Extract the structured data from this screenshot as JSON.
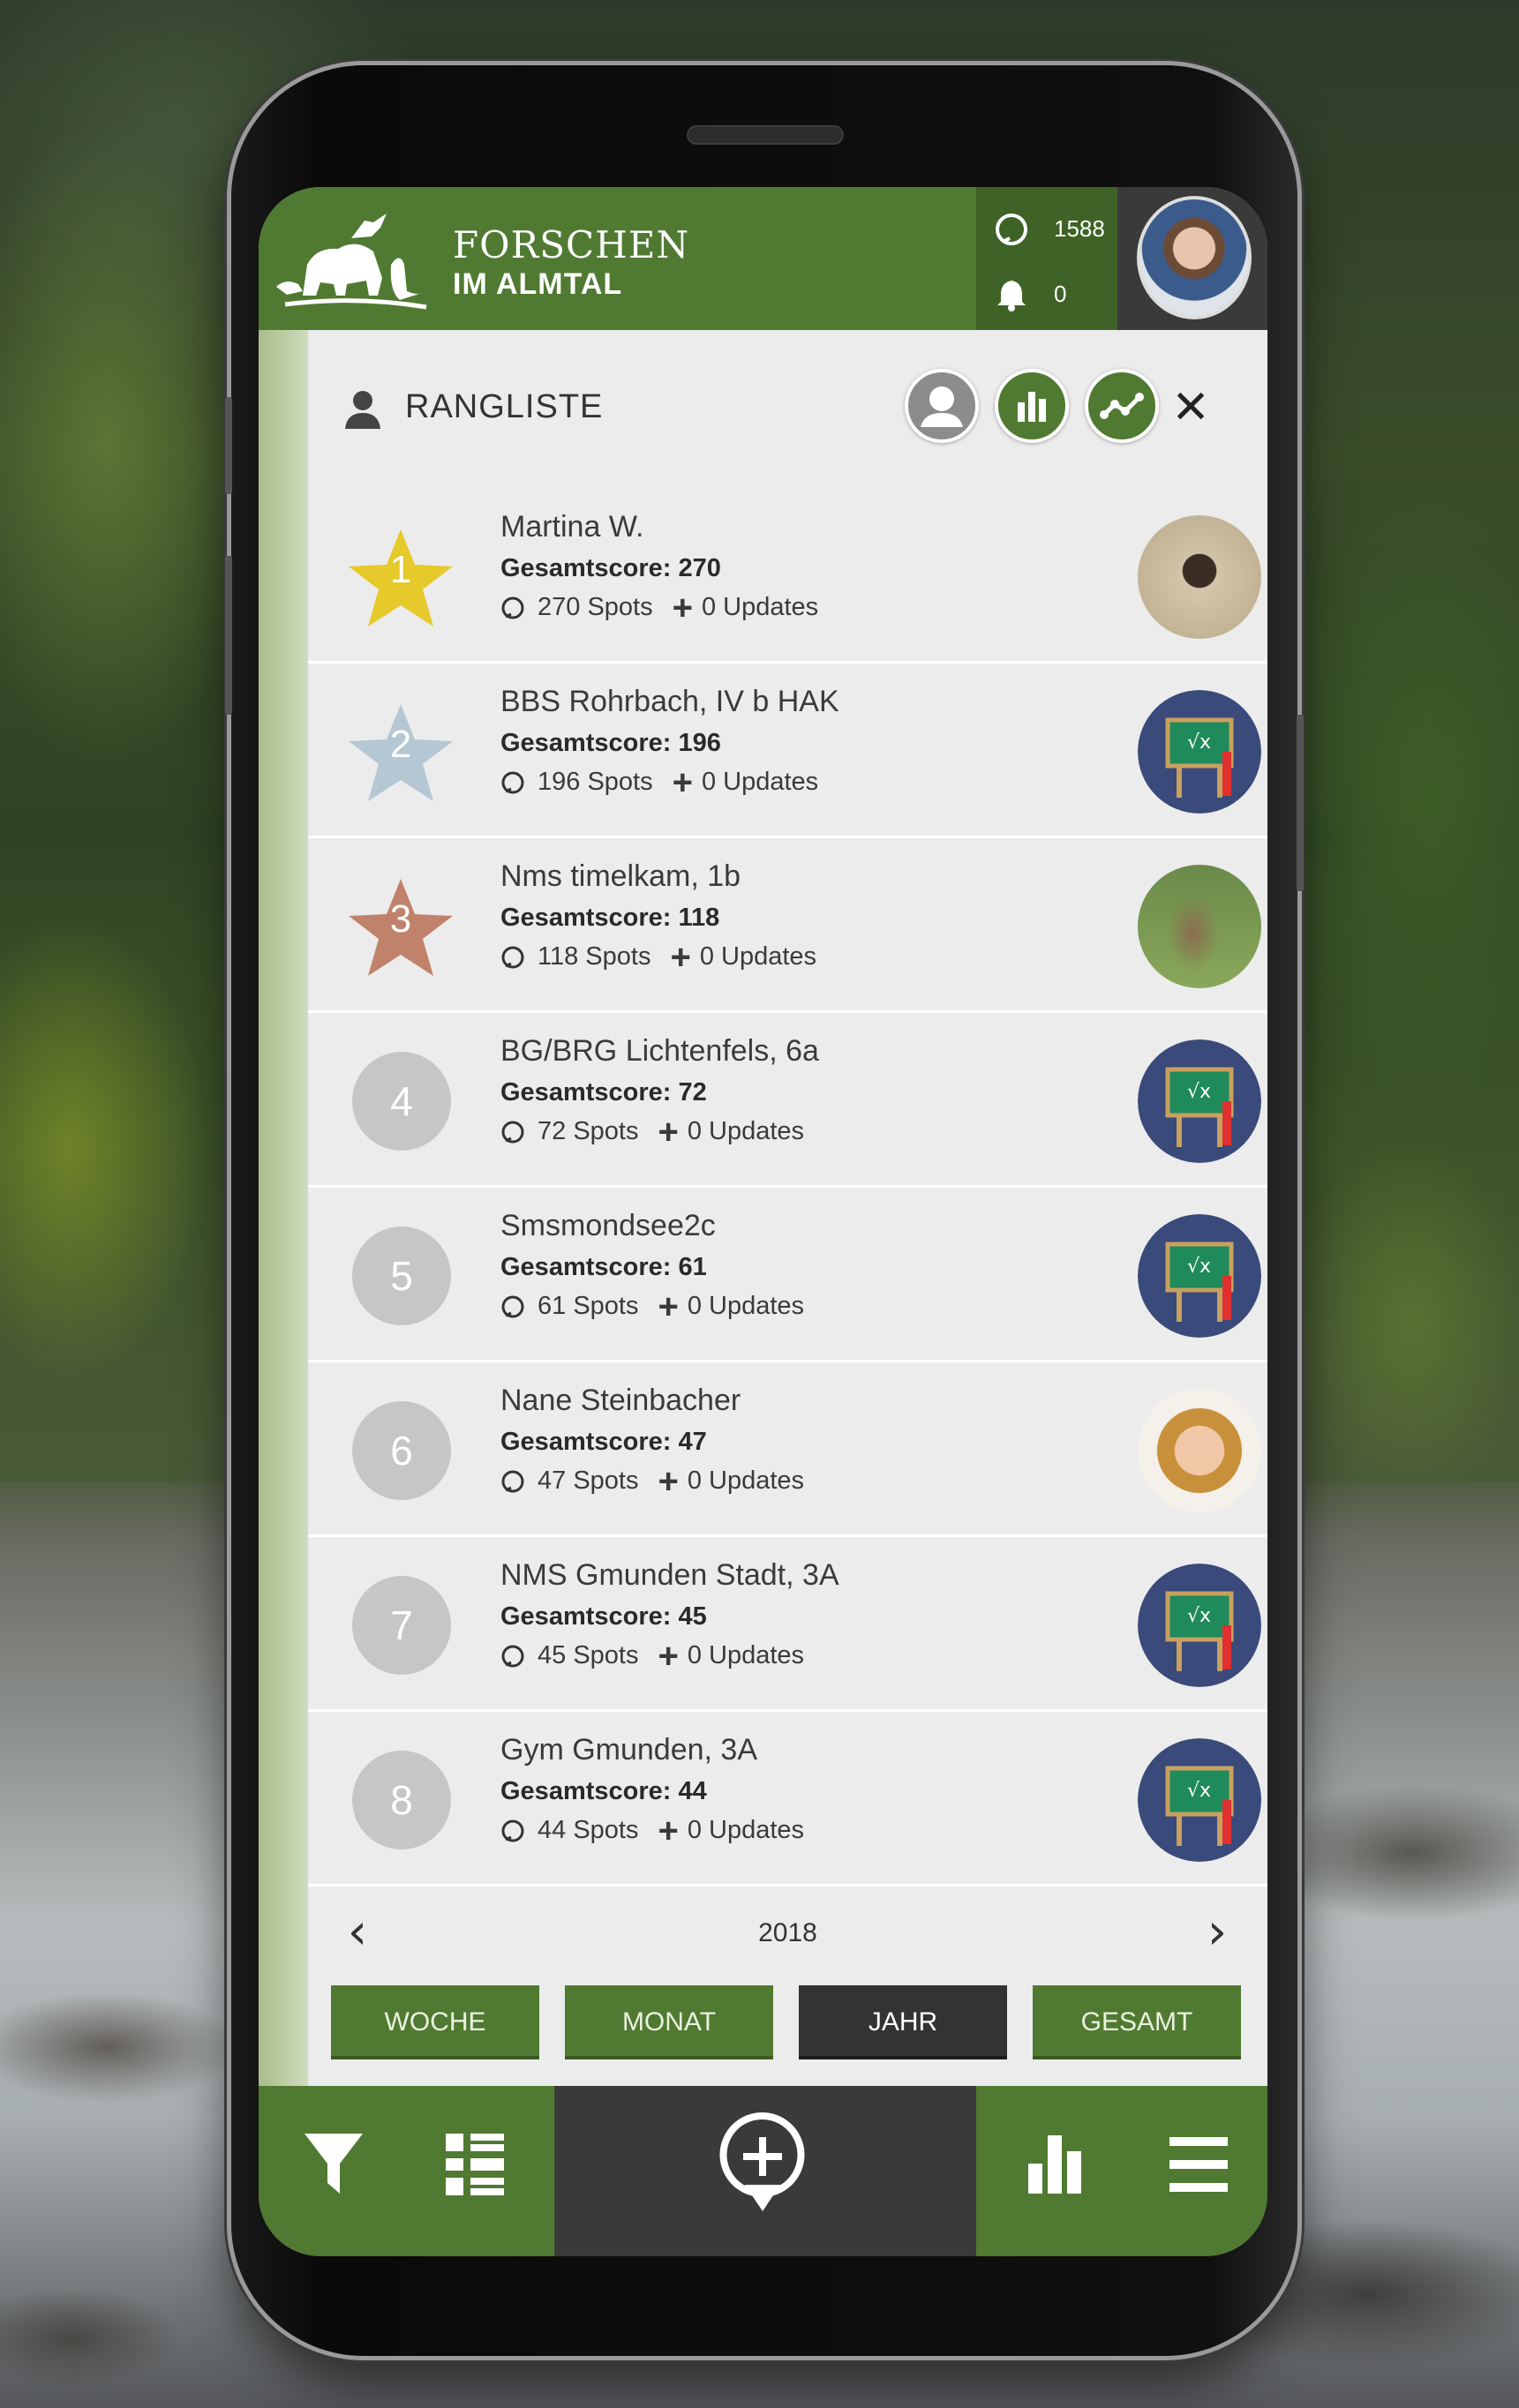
{
  "app": {
    "brand_line1": "FORSCHEN",
    "brand_line2": "IM ALMTAL",
    "header_stats": {
      "spots": "1588",
      "notifications": "0"
    }
  },
  "panel": {
    "title": "RANGLISTE",
    "filter_icons": [
      "user-icon",
      "bar-chart-icon",
      "trend-icon"
    ],
    "close_label": "✕"
  },
  "leaderboard": [
    {
      "rank": "1",
      "name": "Martina W.",
      "score": "Gesamtscore: 270",
      "spots": "270 Spots",
      "updates": "0 Updates",
      "avatar": "bird"
    },
    {
      "rank": "2",
      "name": "BBS Rohrbach, IV b HAK",
      "score": "Gesamtscore: 196",
      "spots": "196 Spots",
      "updates": "0 Updates",
      "avatar": "school"
    },
    {
      "rank": "3",
      "name": "Nms timelkam, 1b",
      "score": "Gesamtscore: 118",
      "spots": "118 Spots",
      "updates": "0 Updates",
      "avatar": "deer"
    },
    {
      "rank": "4",
      "name": "BG/BRG Lichtenfels, 6a",
      "score": "Gesamtscore: 72",
      "spots": "72 Spots",
      "updates": "0 Updates",
      "avatar": "school"
    },
    {
      "rank": "5",
      "name": "Smsmondsee2c",
      "score": "Gesamtscore: 61",
      "spots": "61 Spots",
      "updates": "0 Updates",
      "avatar": "school"
    },
    {
      "rank": "6",
      "name": "Nane Steinbacher",
      "score": "Gesamtscore: 47",
      "spots": "47 Spots",
      "updates": "0 Updates",
      "avatar": "person"
    },
    {
      "rank": "7",
      "name": "NMS Gmunden Stadt, 3A",
      "score": "Gesamtscore: 45",
      "spots": "45 Spots",
      "updates": "0 Updates",
      "avatar": "school"
    },
    {
      "rank": "8",
      "name": "Gym Gmunden, 3A",
      "score": "Gesamtscore: 44",
      "spots": "44 Spots",
      "updates": "0 Updates",
      "avatar": "school"
    }
  ],
  "year_nav": {
    "prev": "‹",
    "year": "2018",
    "next": "›"
  },
  "period_tabs": [
    {
      "label": "WOCHE",
      "active": false
    },
    {
      "label": "MONAT",
      "active": false
    },
    {
      "label": "JAHR",
      "active": true
    },
    {
      "label": "GESAMT",
      "active": false
    }
  ],
  "bottom_nav": [
    "filter-icon",
    "list-icon",
    "add-spot-icon",
    "ranking-icon",
    "menu-icon"
  ],
  "colors": {
    "brand_green": "#507a31",
    "dark_green": "#3f6326",
    "gold": "#e6c92a",
    "silver": "#b5c7d3",
    "bronze": "#c0826a",
    "active_tab": "#333333"
  }
}
